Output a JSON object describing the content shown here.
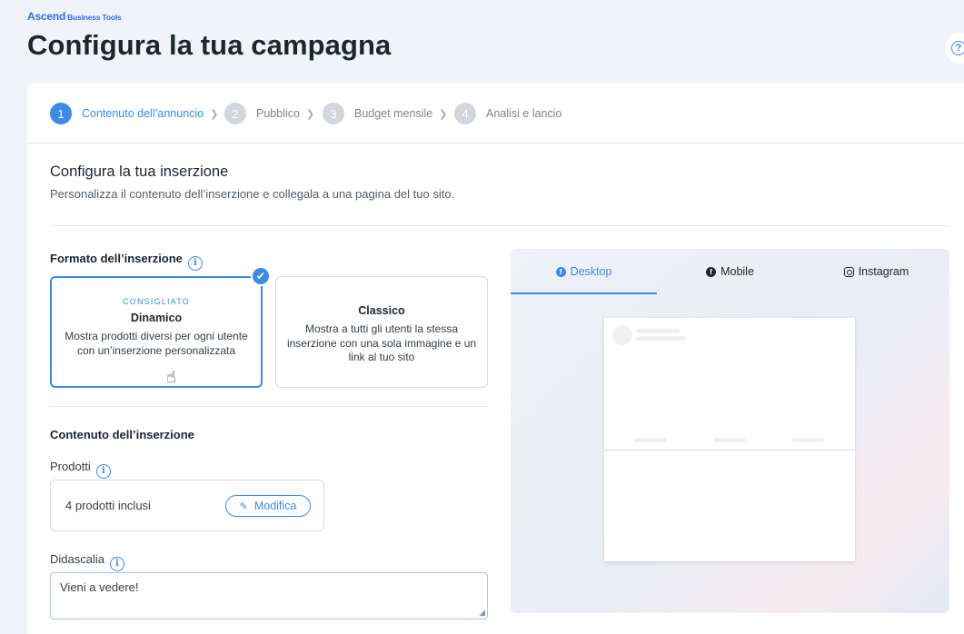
{
  "brand": {
    "name": "Ascend",
    "sub": "Business Tools"
  },
  "page": {
    "title": "Configura la tua campagna",
    "help_icon": "?"
  },
  "steps": [
    {
      "num": "1",
      "label": "Contenuto dell’annuncio"
    },
    {
      "num": "2",
      "label": "Pubblico"
    },
    {
      "num": "3",
      "label": "Budget mensile"
    },
    {
      "num": "4",
      "label": "Analisi e lancio"
    }
  ],
  "section": {
    "title": "Configura la tua inserzione",
    "subtitle": "Personalizza il contenuto dell’inserzione e collegala a una pagina del tuo sito."
  },
  "format": {
    "label": "Formato dell’inserzione",
    "options": [
      {
        "badge": "CONSIGLIATO",
        "name": "Dinamico",
        "desc": "Mostra prodotti diversi per ogni utente con un’inserzione personalizzata"
      },
      {
        "name": "Classico",
        "desc": "Mostra a tutti gli utenti la stessa inserzione con una sola immagine e un link al tuo sito"
      }
    ]
  },
  "content": {
    "label": "Contenuto dell’inserzione",
    "products_label": "Prodotti",
    "products_count": "4 prodotti inclusi",
    "edit_label": "Modifica",
    "caption_label": "Didascalia",
    "caption_value": "Vieni a vedere!"
  },
  "preview": {
    "tabs": [
      "Desktop",
      "Mobile",
      "Instagram"
    ],
    "active_tab": "Desktop"
  },
  "colors": {
    "accent": "#3b8beb",
    "brand": "#2e6fe8",
    "text": "#1a2733"
  },
  "icons": [
    "help-icon",
    "chevron-right-icon",
    "info-icon",
    "checkmark-icon",
    "hand-cursor-icon",
    "pencil-icon",
    "facebook-icon",
    "instagram-icon",
    "resize-handle-icon"
  ]
}
